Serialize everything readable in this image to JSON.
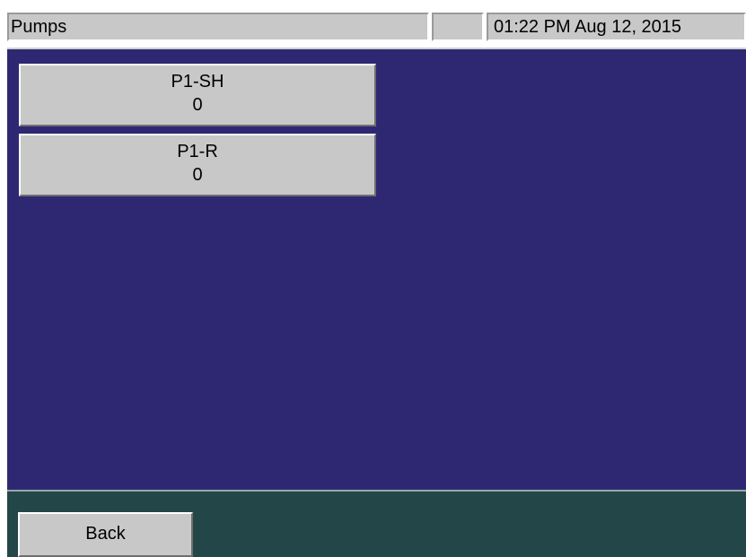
{
  "header": {
    "title": "Pumps",
    "status": "",
    "datetime": "01:22 PM Aug 12, 2015"
  },
  "pumps": [
    {
      "name": "P1-SH",
      "value": "0"
    },
    {
      "name": "P1-R",
      "value": "0"
    }
  ],
  "footer": {
    "back_label": "Back"
  },
  "colors": {
    "screen_background": "#2e2872",
    "footer_background": "#234749",
    "button_face": "#c8c8c8"
  }
}
